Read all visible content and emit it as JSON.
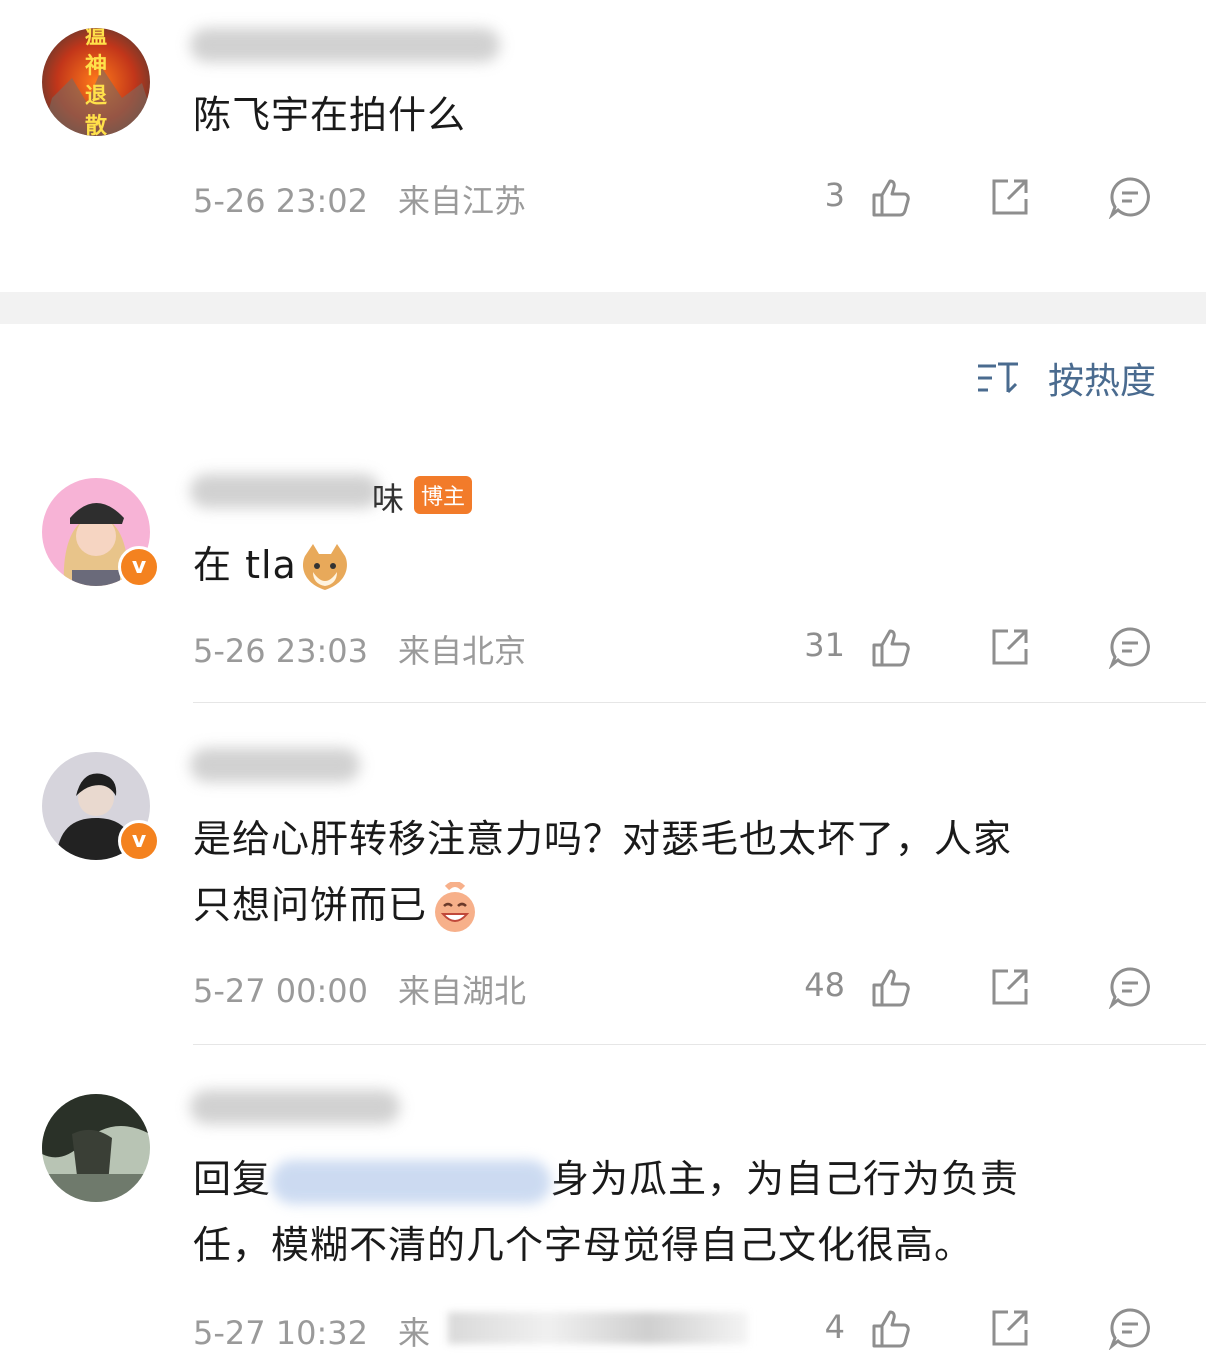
{
  "comments": [
    {
      "text": "陈飞宇在拍什么",
      "time": "5-26 23:02",
      "location": "来自江苏",
      "likes": "3",
      "avatar_text": [
        "瘟",
        "神",
        "退",
        "散"
      ]
    },
    {
      "tag": "博主",
      "name_tail": "味",
      "text": "在 tla",
      "time": "5-26 23:03",
      "location": "来自北京",
      "likes": "31",
      "verified_badge": "v"
    },
    {
      "text_line1": "是给心肝转移注意力吗？对瑟毛也太坏了，人家",
      "text_line2": "只想问饼而已",
      "time": "5-27 00:00",
      "location": "来自湖北",
      "likes": "48",
      "verified_badge": "v"
    },
    {
      "reply_prefix": "回复",
      "text_line1_suffix": "身为瓜主，为自己行为负责",
      "text_line2": "任，模糊不清的几个字母觉得自己文化很高。",
      "time": "5-27 10:32",
      "location": "来",
      "likes": "4"
    }
  ],
  "sort": {
    "label": "按热度",
    "icon": "sort-icon"
  },
  "icons": {
    "like": "thumbs-up-icon",
    "repost": "repost-icon",
    "comment": "comment-icon"
  },
  "colors": {
    "accent": "#4a6b8f",
    "verified": "#f4821f",
    "tag": "#f27b2a"
  }
}
